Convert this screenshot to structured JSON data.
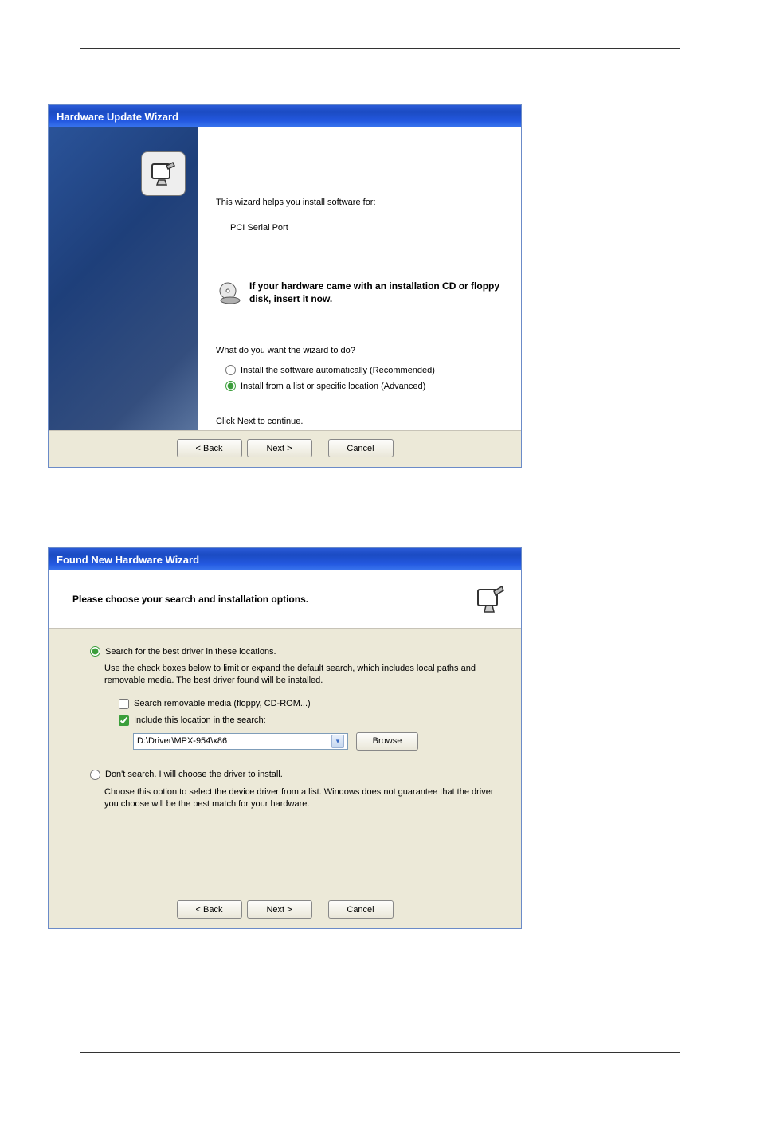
{
  "dialog1": {
    "title": "Hardware Update Wizard",
    "intro": "This wizard helps you install software for:",
    "device_name": "PCI Serial Port",
    "cd_hint": "If your hardware came with an installation CD or floppy disk, insert it now.",
    "question": "What do you want the wizard to do?",
    "options": {
      "auto": "Install the software automatically (Recommended)",
      "advanced": "Install from a list or specific location (Advanced)"
    },
    "selected": "advanced",
    "click_next": "Click Next to continue.",
    "buttons": {
      "back": "< Back",
      "next": "Next >",
      "cancel": "Cancel"
    }
  },
  "dialog2": {
    "title": "Found New Hardware Wizard",
    "heading": "Please choose your search and installation options.",
    "optionA": {
      "label": "Search for the best driver in these locations.",
      "desc": "Use the check boxes below to limit or expand the default search, which includes local paths and removable media. The best driver found will be installed.",
      "check_removable": "Search removable media (floppy, CD-ROM...)",
      "check_removable_checked": false,
      "check_include": "Include this location in the search:",
      "check_include_checked": true,
      "path_value": "D:\\Driver\\MPX-954\\x86",
      "browse_label": "Browse"
    },
    "optionB": {
      "label": "Don't search. I will choose the driver to install.",
      "desc": "Choose this option to select the device driver from a list.  Windows does not guarantee that the driver you choose will be the best match for your hardware."
    },
    "selected": "A",
    "buttons": {
      "back": "< Back",
      "next": "Next >",
      "cancel": "Cancel"
    }
  }
}
